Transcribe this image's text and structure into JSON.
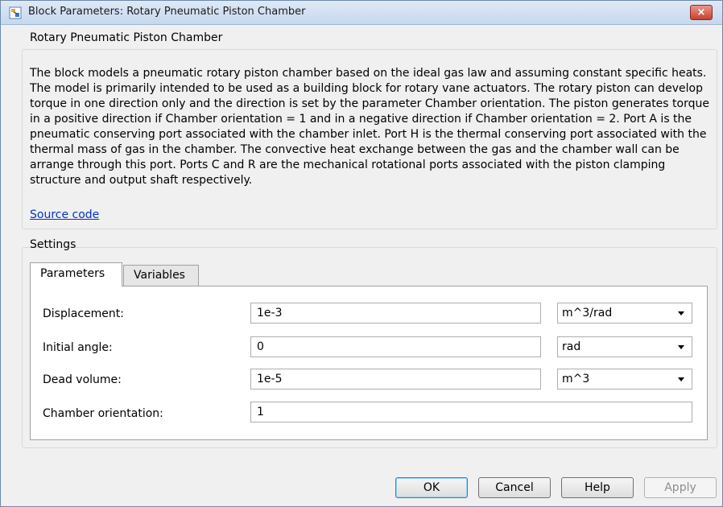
{
  "window": {
    "title": "Block Parameters: Rotary Pneumatic Piston Chamber",
    "close_label": "×"
  },
  "description_group": {
    "title": "Rotary Pneumatic Piston Chamber",
    "text": "The block models a pneumatic rotary piston chamber based on the ideal gas law and assuming constant specific heats. The model is primarily intended to be used as a building block for rotary vane actuators. The rotary piston can develop torque in one direction only and the direction is set by the parameter Chamber orientation. The piston generates torque in a positive direction if Chamber orientation = 1 and in a negative direction if Chamber orientation = 2. Port A is the pneumatic conserving port associated with the chamber inlet. Port H is the thermal conserving port associated with the thermal mass of gas in the chamber. The convective heat exchange between the gas and the chamber wall can be arrange through this port. Ports C and R are the mechanical rotational ports associated with the piston clamping structure and output shaft respectively.",
    "source_link": "Source code"
  },
  "settings": {
    "title": "Settings",
    "tabs": [
      {
        "label": "Parameters",
        "active": true
      },
      {
        "label": "Variables",
        "active": false
      }
    ],
    "params": [
      {
        "label": "Displacement:",
        "value": "1e-3",
        "unit": "m^3/rad"
      },
      {
        "label": "Initial angle:",
        "value": "0",
        "unit": "rad"
      },
      {
        "label": "Dead volume:",
        "value": "1e-5",
        "unit": "m^3"
      },
      {
        "label": "Chamber orientation:",
        "value": "1"
      }
    ]
  },
  "buttons": {
    "ok": "OK",
    "cancel": "Cancel",
    "help": "Help",
    "apply": "Apply"
  },
  "icons": {
    "app": "simulink-block-icon",
    "close": "close-icon"
  },
  "colors": {
    "link": "#0033cc",
    "close_button": "#c6402f"
  }
}
